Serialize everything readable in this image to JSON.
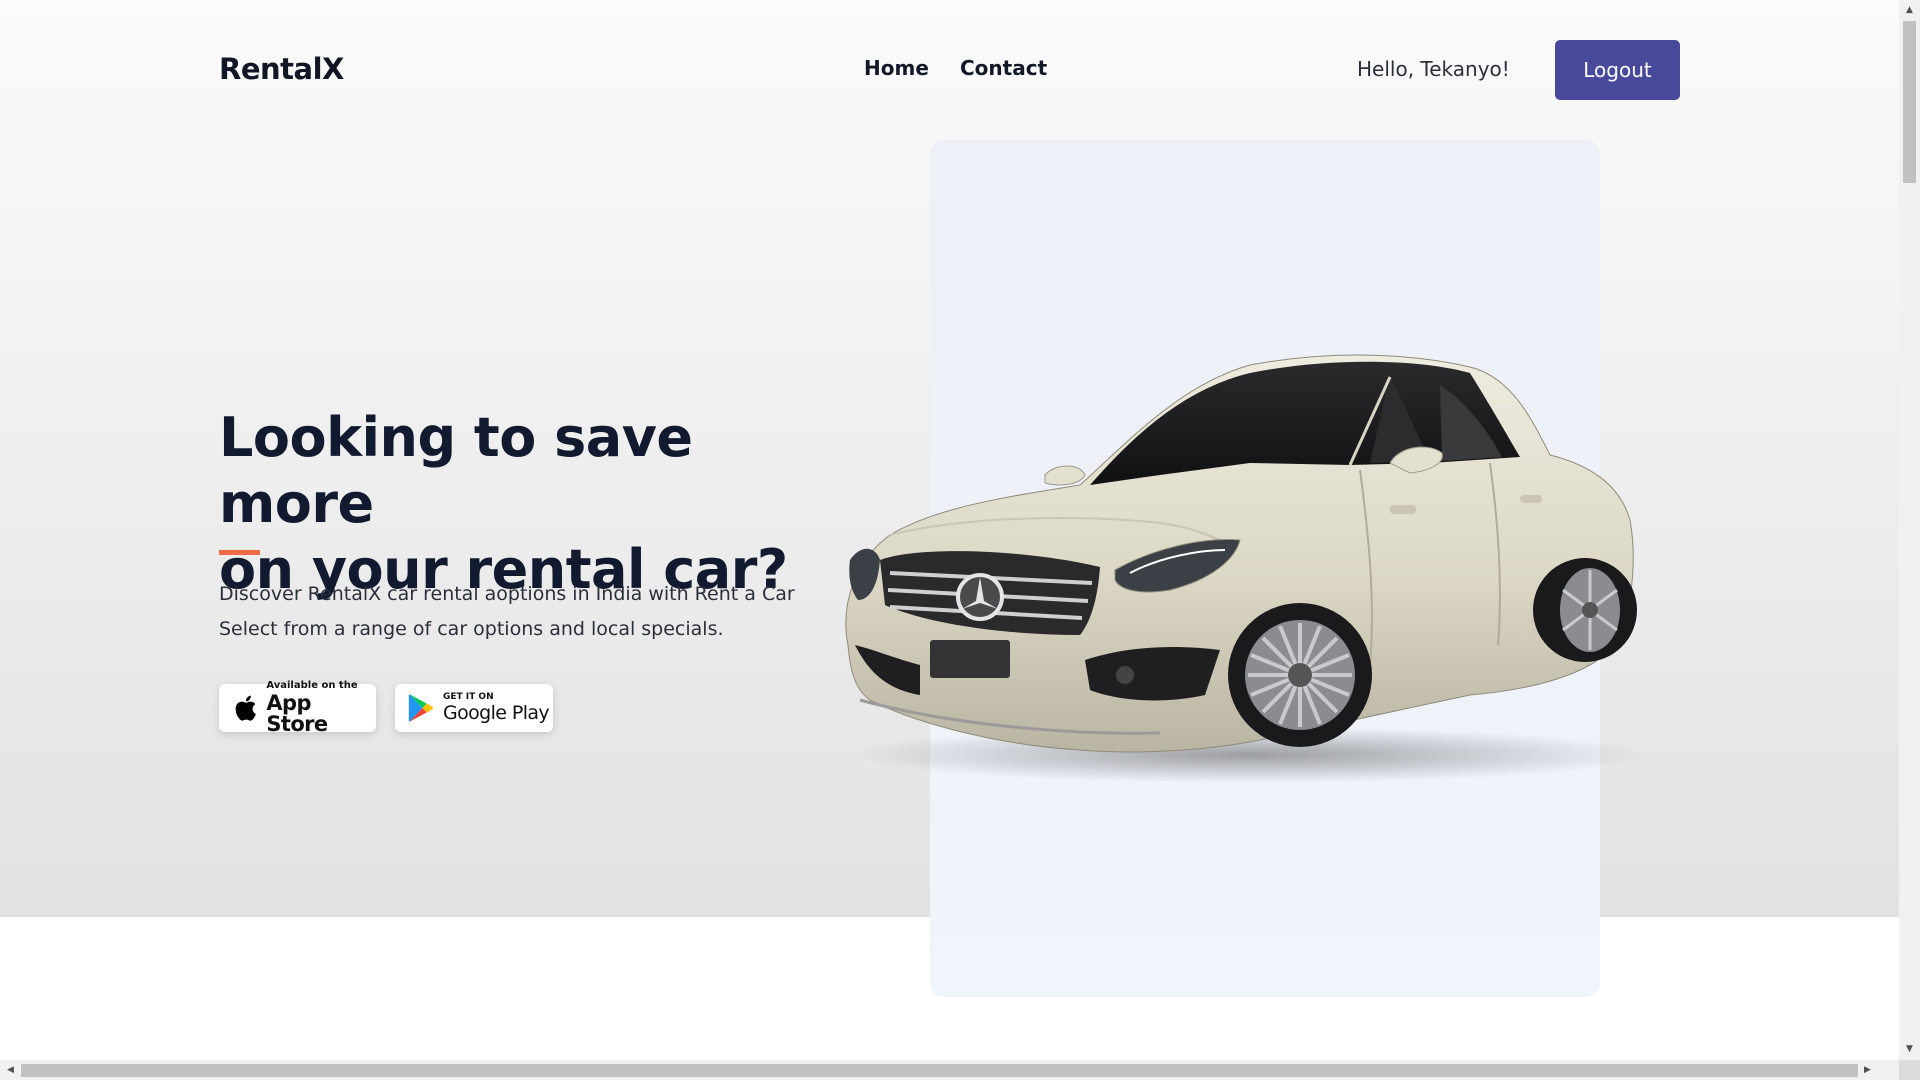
{
  "nav": {
    "logo": "RentalX",
    "links": [
      {
        "label": "Home"
      },
      {
        "label": "Contact"
      }
    ],
    "greeting": "Hello, Tekanyo!",
    "logout_label": "Logout"
  },
  "hero": {
    "headline_line1": "Looking to save more",
    "headline_line2": "on your rental car?",
    "subtext_line1": "Discover RentalX car rental aoptions in India with Rent a Car",
    "subtext_line2": "Select from a range of car options and local specials.",
    "accent_color": "#f06b45",
    "image": "white-sedan-car-image"
  },
  "store_buttons": {
    "app_store": {
      "small": "Available on the",
      "big": "App Store",
      "icon": "apple-icon"
    },
    "google_play": {
      "small": "GET IT ON",
      "big": "Google Play",
      "icon": "google-play-icon"
    }
  },
  "colors": {
    "primary_button": "#48499b",
    "heading": "#121a30",
    "panel": "#eef2f8"
  }
}
